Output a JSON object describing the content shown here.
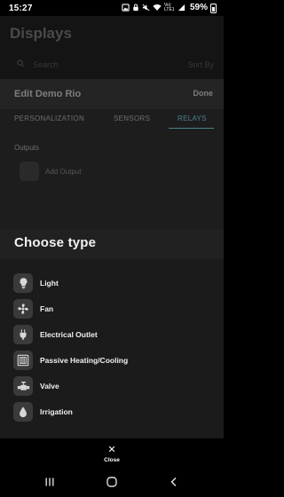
{
  "status_bar": {
    "time": "15:27",
    "network_label": "Vo) LTE1",
    "battery_percent": "59%",
    "icons": [
      "photo-notification-icon",
      "lock-icon",
      "mute-icon",
      "wifi-icon",
      "signal-icon",
      "battery-icon"
    ]
  },
  "background_app": {
    "title": "Displays",
    "search_placeholder": "Search",
    "sort_label": "Sort By",
    "edit_title": "Edit Demo Rio",
    "done_label": "Done",
    "tabs": [
      "PERSONALIZATION",
      "SENSORS",
      "RELAYS"
    ],
    "active_tab": "RELAYS",
    "outputs_label": "Outputs",
    "add_output_label": "Add Output"
  },
  "sheet": {
    "title": "Choose type",
    "types": [
      {
        "label": "Light",
        "icon": "light-bulb-icon"
      },
      {
        "label": "Fan",
        "icon": "fan-icon"
      },
      {
        "label": "Electrical Outlet",
        "icon": "electrical-plug-icon"
      },
      {
        "label": "Passive Heating/Cooling",
        "icon": "radiator-icon"
      },
      {
        "label": "Valve",
        "icon": "valve-icon"
      },
      {
        "label": "Irrigation",
        "icon": "water-drop-icon"
      }
    ],
    "close_label": "Close"
  },
  "nav_bar": {
    "icons": [
      "recents-icon",
      "home-icon",
      "back-icon"
    ]
  },
  "colors": {
    "accent": "#47838d",
    "sheet_background": "#1b1b1b",
    "icon_tile": "#3a3a3a"
  }
}
